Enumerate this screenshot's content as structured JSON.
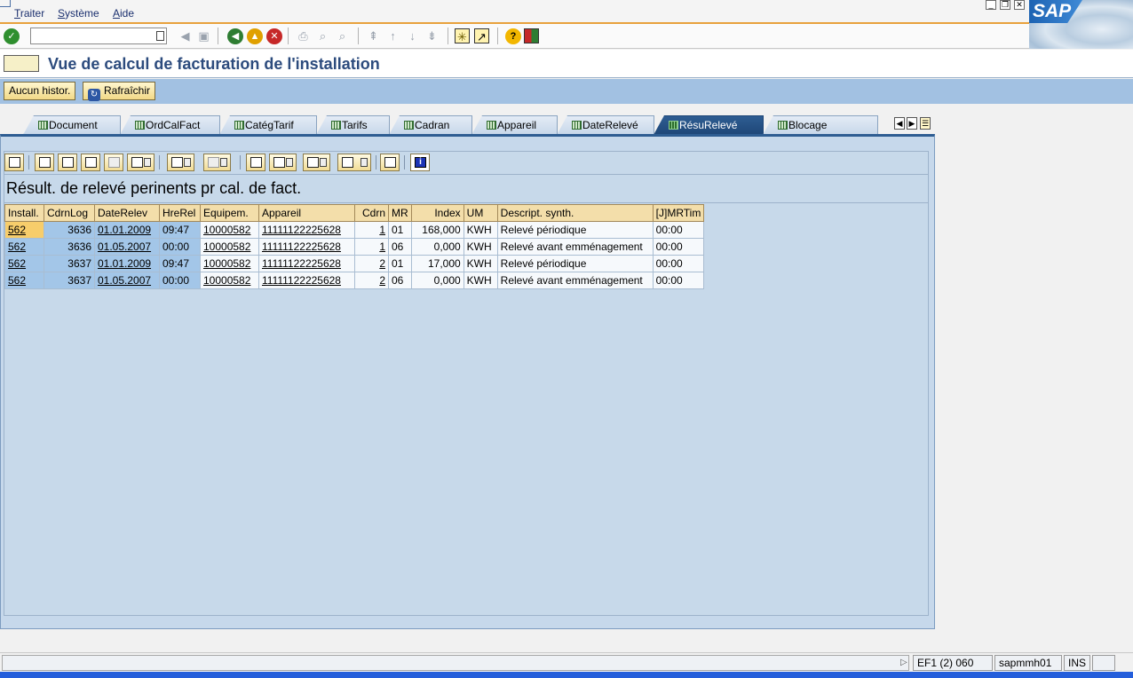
{
  "menu": {
    "items": [
      "Traiter",
      "Système",
      "Aide"
    ]
  },
  "window_controls": {
    "minimize": "_",
    "restore": "❐",
    "close": "✕"
  },
  "logo": {
    "text": "SAP"
  },
  "command_field": {
    "value": ""
  },
  "page": {
    "title": "Vue de calcul de facturation de l'installation"
  },
  "app_toolbar": {
    "history_button": "Aucun histor.",
    "refresh_button": "Rafraîchir"
  },
  "tabs": [
    {
      "label": "Document",
      "active": false
    },
    {
      "label": "OrdCalFact",
      "active": false
    },
    {
      "label": "CatégTarif",
      "active": false
    },
    {
      "label": "Tarifs",
      "active": false
    },
    {
      "label": "Cadran",
      "active": false
    },
    {
      "label": "Appareil",
      "active": false
    },
    {
      "label": "DateRelevé",
      "active": false
    },
    {
      "label": "RésuRelevé",
      "active": true
    },
    {
      "label": "Blocage",
      "active": false
    }
  ],
  "grid": {
    "title": "Résult. de relevé perinents pr cal. de fact.",
    "columns": [
      "Install.",
      "CdrnLog",
      "DateRelev",
      "HreRel",
      "Equipem.",
      "Appareil",
      "Cdrn",
      "MR",
      "Index",
      "UM",
      "Descript. synth.",
      "[J]MRTim"
    ],
    "rows": [
      [
        "562",
        "3636",
        "01.01.2009",
        "09:47",
        "10000582",
        "11111122225628",
        "1",
        "01",
        "168,000",
        "KWH",
        "Relevé périodique",
        "00:00"
      ],
      [
        "562",
        "3636",
        "01.05.2007",
        "00:00",
        "10000582",
        "11111122225628",
        "1",
        "06",
        "0,000",
        "KWH",
        "Relevé avant emménagement",
        "00:00"
      ],
      [
        "562",
        "3637",
        "01.01.2009",
        "09:47",
        "10000582",
        "11111122225628",
        "2",
        "01",
        "17,000",
        "KWH",
        "Relevé périodique",
        "00:00"
      ],
      [
        "562",
        "3637",
        "01.05.2007",
        "00:00",
        "10000582",
        "11111122225628",
        "2",
        "06",
        "0,000",
        "KWH",
        "Relevé avant emménagement",
        "00:00"
      ]
    ]
  },
  "status": {
    "system": "EF1 (2) 060",
    "server": "sapmmh01",
    "mode": "INS"
  }
}
